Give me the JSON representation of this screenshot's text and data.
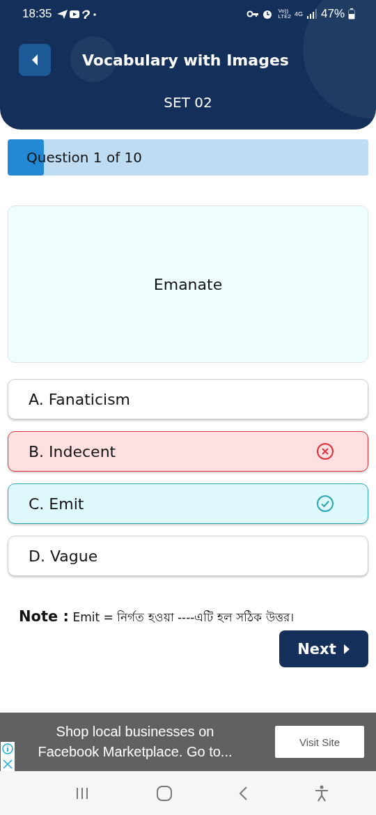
{
  "status_bar": {
    "time": "18:35",
    "network_top": "Vo))",
    "network_bottom": "LTE2",
    "data_type": "4G",
    "battery": "47%"
  },
  "header": {
    "title": "Vocabulary with Images",
    "subtitle": "SET 02"
  },
  "progress": {
    "label": "Question 1 of 10",
    "level": 0.1
  },
  "question": {
    "word": "Emanate"
  },
  "options": [
    {
      "label": "A. Fanaticism",
      "kind": "neutral"
    },
    {
      "label": "B. Indecent",
      "kind": "wrong"
    },
    {
      "label": "C. Emit",
      "kind": "correct"
    },
    {
      "label": "D. Vague",
      "kind": "neutral"
    }
  ],
  "note": {
    "label": "Note :",
    "text": "Emit =  নির্গত হওয়া ----এটি হল সঠিক উত্তর।"
  },
  "next_button": "Next",
  "ad": {
    "text": "Shop local businesses on Facebook Marketplace. Go to...",
    "button": "Visit Site"
  }
}
